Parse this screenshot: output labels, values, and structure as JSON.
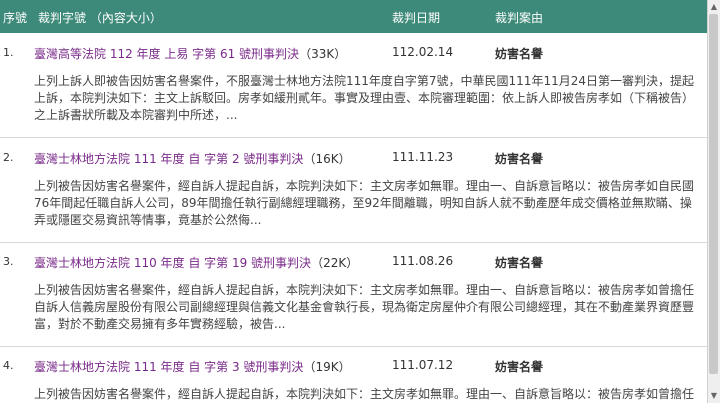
{
  "header": {
    "col_no": "序號",
    "col_case": "裁判字號 （內容大小）",
    "col_date": "裁判日期",
    "col_cause": "裁判案由"
  },
  "rows": [
    {
      "no": "1.",
      "case": "臺灣高等法院 112 年度 上易 字第 61 號刑事判決",
      "size": "（33K）",
      "date": "112.02.14",
      "cause": "妨害名譽",
      "summary": "上列上訴人即被告因妨害名譽案件，不服臺灣士林地方法院111年度自字第7號，中華民國111年11月24日第一審判決，提起上訴，本院判決如下：主文上訴駁回。房孝如緩刑貳年。事實及理由壹、本院審理範圍：依上訴人即被告房孝如（下稱被告）之上訴書狀所載及本院審判中所述，..."
    },
    {
      "no": "2.",
      "case": "臺灣士林地方法院 111 年度 自 字第 2 號刑事判決",
      "size": "（16K）",
      "date": "111.11.23",
      "cause": "妨害名譽",
      "summary": "上列被告因妨害名譽案件，經自訴人提起自訴，本院判決如下：主文房孝如無罪。理由一、自訴意旨略以：被告房孝如自民國76年間起任職自訴人公司，89年間擔任執行副總經理職務，至92年間離職，明知自訴人就不動產歷年成交價格並無欺瞞、操弄或隱匿交易資訊等情事，竟基於公然侮..."
    },
    {
      "no": "3.",
      "case": "臺灣士林地方法院 110 年度 自 字第 19 號刑事判決",
      "size": "（22K）",
      "date": "111.08.26",
      "cause": "妨害名譽",
      "summary": "上列被告因妨害名譽案件，經自訴人提起自訴，本院判決如下：主文房孝如無罪。理由一、自訴意旨略以：被告房孝如曾擔任自訴人信義房屋股份有限公司副總經理與信義文化基金會執行長，現為衛定房屋仲介有限公司總經理，其在不動產業界資歷豐富，對於不動產交易擁有多年實務經驗，被告..."
    },
    {
      "no": "4.",
      "case": "臺灣士林地方法院 111 年度 自 字第 3 號刑事判決",
      "size": "（19K）",
      "date": "111.07.12",
      "cause": "妨害名譽",
      "summary": "上列被告因妨害名譽案件，經自訴人提起自訴，本院判決如下：主文房孝如無罪。理由一、自訴意旨略以：被告房孝如曾擔任自訴人"
    }
  ],
  "colors": {
    "header_bg": "#3d8a7a",
    "link": "#7a2a8a"
  }
}
